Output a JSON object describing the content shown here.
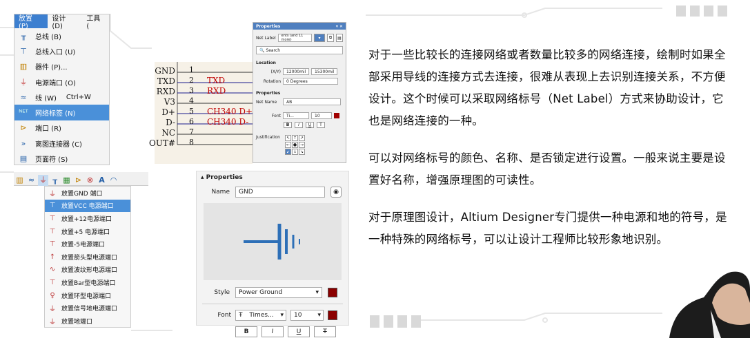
{
  "menu": {
    "tabs": [
      "放置 (P)",
      "设计 (D)",
      "工具 ("
    ],
    "items": [
      {
        "label": "总线 (B)",
        "icon": "bus-icon"
      },
      {
        "label": "总线入口 (U)",
        "icon": "bus-entry-icon"
      },
      {
        "label": "器件 (P)...",
        "icon": "part-icon"
      },
      {
        "label": "电源端口 (O)",
        "icon": "power-port-icon"
      },
      {
        "label": "线 (W)",
        "icon": "wire-icon",
        "shortcut": "Ctrl+W"
      },
      {
        "label": "网络标签 (N)",
        "icon": "net-label-icon"
      },
      {
        "label": "端口 (R)",
        "icon": "port-icon"
      },
      {
        "label": "离图连接器 (C)",
        "icon": "off-sheet-connector-icon"
      },
      {
        "label": "页面符 (S)",
        "icon": "sheet-symbol-icon"
      }
    ]
  },
  "schematic": {
    "pins": [
      {
        "name": "GND",
        "num": "1",
        "net": ""
      },
      {
        "name": "TXD",
        "num": "2",
        "net": "TXD"
      },
      {
        "name": "RXD",
        "num": "3",
        "net": "RXD"
      },
      {
        "name": "V3",
        "num": "4",
        "net": ""
      },
      {
        "name": "D+",
        "num": "5",
        "net": "CH340_D+"
      },
      {
        "name": "D-",
        "num": "6",
        "net": "CH340_D-"
      },
      {
        "name": "NC",
        "num": "7",
        "net": ""
      },
      {
        "name": "OUT#",
        "num": "8",
        "net": ""
      }
    ]
  },
  "props_small": {
    "title": "Properties",
    "subtitle": "Net Label",
    "filter_text": "ents (and 11 more)",
    "search_placeholder": "Search",
    "location": "Location",
    "x_label": "(X/Y)",
    "x_value": "12000mil",
    "y_value": "15300mil",
    "rotation_label": "Rotation",
    "rotation_value": "0 Degrees",
    "properties": "Properties",
    "netname_label": "Net Name",
    "netname_value": "AB",
    "font_label": "Font",
    "font_value": "Ti...",
    "font_size": "10",
    "justification": "Justification"
  },
  "toolbar2": {
    "icons": [
      "part-icon",
      "wire-icon",
      "power-port-icon",
      "bus-icon",
      "component-icon",
      "port-icon",
      "no-erc-icon",
      "text-icon",
      "arc-icon"
    ]
  },
  "power_menu": {
    "items": [
      {
        "label": "放置GND 端口"
      },
      {
        "label": "放置VCC 电源端口"
      },
      {
        "label": "放置+12电源端口"
      },
      {
        "label": "放置+5 电源端口"
      },
      {
        "label": "放置-5电源端口"
      },
      {
        "label": "放置箭头型电源端口"
      },
      {
        "label": "放置波纹形电源端口"
      },
      {
        "label": "放置Bar型电源端口"
      },
      {
        "label": "放置环型电源端口"
      },
      {
        "label": "放置信号地电源端口"
      },
      {
        "label": "放置地端口"
      }
    ]
  },
  "props_large": {
    "title": "Properties",
    "name_label": "Name",
    "name_value": "GND",
    "style_label": "Style",
    "style_value": "Power Ground",
    "font_label": "Font",
    "font_value": "Times...",
    "font_size": "10",
    "format_buttons": [
      "B",
      "I",
      "U",
      "T"
    ]
  },
  "text": {
    "p1": "对于一些比较长的连接网络或者数量比较多的网络连接，绘制时如果全部采用导线的连接方式去连接，很难从表现上去识别连接关系，不方便设计。这个时候可以采取网络标号（Net Label）方式来协助设计，它也是网络连接的一种。",
    "p2": "可以对网络标号的颜色、名称、是否锁定进行设置。一般来说主要是设置好名称，增强原理图的可读性。",
    "p3": "对于原理图设计，Altium Designer专门提供一种电源和地的符号，是一种特殊的网络标号，可以让设计工程师比较形象地识别。"
  },
  "colors": {
    "accent": "#2e6db5",
    "highlight": "#4a90d9",
    "net_red": "#c00000",
    "wire_blue": "#1a1a8c",
    "swatch": "#8b0000"
  }
}
